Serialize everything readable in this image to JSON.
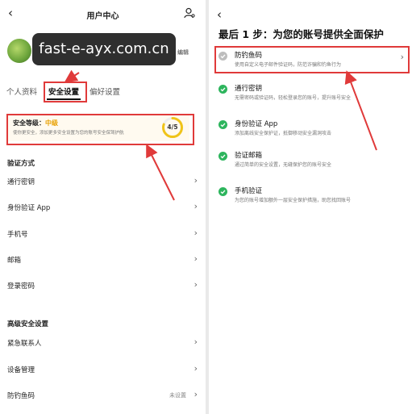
{
  "watermark": "fast-e-ayx.com.cn",
  "left": {
    "header": {
      "title": "用户中心"
    },
    "profile": {
      "edit_label": "编辑"
    },
    "tabs": [
      {
        "label": "个人资料",
        "active": false
      },
      {
        "label": "安全设置",
        "active": true
      },
      {
        "label": "偏好设置",
        "active": false
      }
    ],
    "security_card": {
      "title_prefix": "安全等级：",
      "level": "中级",
      "description": "使你更安全，添加更多安全设置为您的账号安全保驾护航",
      "progress_text": "4/5",
      "progress": 0.8
    },
    "verify_group": {
      "title": "验证方式",
      "items": [
        {
          "label": "通行密钥"
        },
        {
          "label": "身份验证 App"
        },
        {
          "label": "手机号"
        },
        {
          "label": "邮箱"
        },
        {
          "label": "登录密码"
        }
      ]
    },
    "advanced_group": {
      "title": "高级安全设置",
      "items": [
        {
          "label": "紧急联系人",
          "value": ""
        },
        {
          "label": "设备管理",
          "value": ""
        },
        {
          "label": "防钓鱼码",
          "value": "未设置"
        }
      ]
    }
  },
  "right": {
    "title": "最后 1 步：为您的账号提供全面保护",
    "steps": [
      {
        "title": "防钓鱼码",
        "desc": "使用自定义电子邮件验证码，防范诈骗和钓鱼行为",
        "done": false
      },
      {
        "title": "通行密钥",
        "desc": "无需密码或验证码，轻松登录您的账号，提升账号安全",
        "done": true
      },
      {
        "title": "身份验证 App",
        "desc": "添加离线安全保护证，抵御移动安全漏洞攻击",
        "done": true
      },
      {
        "title": "验证邮箱",
        "desc": "通过简单的安全设置，无缝保护您的账号安全",
        "done": true
      },
      {
        "title": "手机验证",
        "desc": "为您的账号增加额外一层安全保护措施，助您找回账号",
        "done": true
      }
    ]
  },
  "colors": {
    "accent_red": "#e03a3a",
    "check_green": "#2db55d",
    "warning": "#e8a000"
  }
}
